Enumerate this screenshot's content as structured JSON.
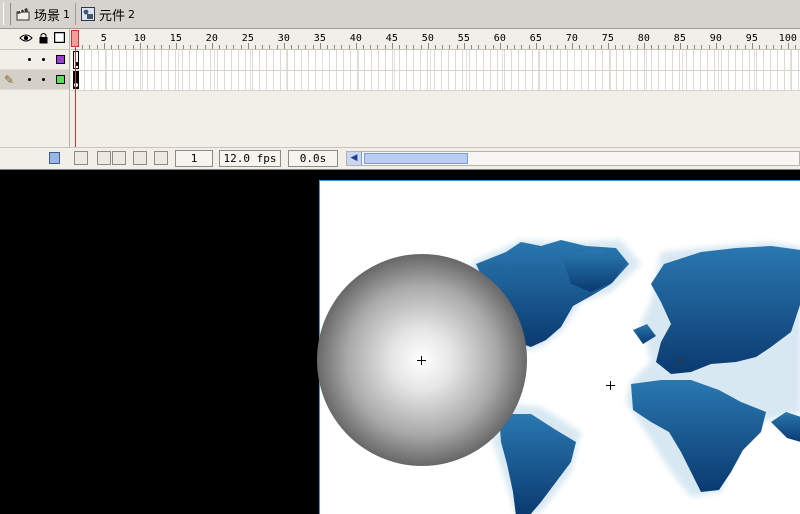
{
  "breadcrumb": {
    "scene": {
      "label": "场景",
      "num": "1",
      "icon": "scene-clapper-icon"
    },
    "symbol": {
      "label": "元件",
      "num": "2",
      "icon": "movieclip-symbol-icon"
    }
  },
  "timeline": {
    "header_icons": [
      "eye-icon",
      "lock-icon",
      "outline-icon"
    ],
    "frame_numbers": [
      "1",
      "5",
      "10",
      "15",
      "20",
      "25",
      "30",
      "35",
      "40",
      "45",
      "50",
      "55",
      "60",
      "65",
      "70",
      "75",
      "80",
      "85",
      "90",
      "95",
      "100"
    ],
    "layers": [
      {
        "color": "#9b3fcf",
        "active": false
      },
      {
        "color": "#55e055",
        "active": true
      }
    ],
    "status": {
      "current_frame": "1",
      "frame_rate": "12.0 fps",
      "elapsed_time": "0.0s"
    }
  },
  "stage": {
    "canvas_color": "#ffffff",
    "background_color": "#000000",
    "map_color": "#0f4f88"
  }
}
